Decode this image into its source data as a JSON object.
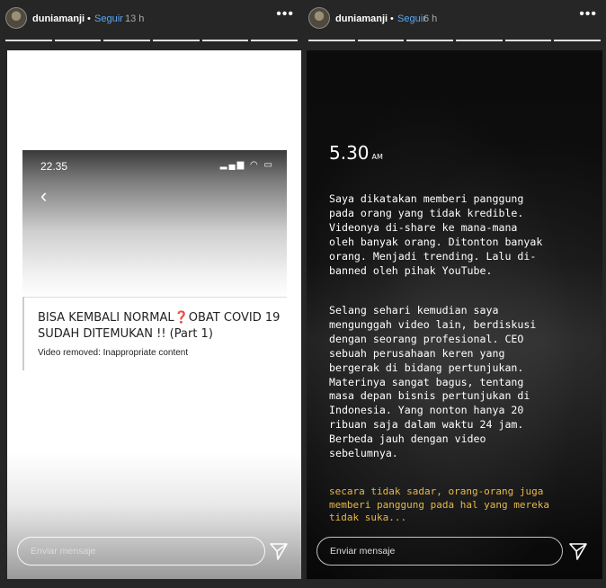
{
  "stories": [
    {
      "username": "duniamanji",
      "separator": "•",
      "follow_label": "Seguir",
      "time": "13 h",
      "more_icon": "more-options-icon",
      "phone": {
        "clock": "22.35",
        "status_icons": "signal-wifi-battery-icons",
        "back_icon": "chevron-left-icon",
        "back_glyph": "‹",
        "video_title": "BISA KEMBALI NORMAL❓OBAT COVID 19 SUDAH DITEMUKAN !!  (Part 1)",
        "video_status": "Video removed: Inappropriate content"
      },
      "message_placeholder": "Enviar mensaje",
      "send_icon": "paper-plane-send-icon"
    },
    {
      "username": "duniamanji",
      "separator": "•",
      "follow_label": "Seguir",
      "time": "6 h",
      "more_icon": "more-options-icon",
      "clock": "5.30",
      "clock_suffix": "AM",
      "paragraph_1": "Saya dikatakan memberi panggung\npada orang yang tidak kredible.\nVideonya di-share ke mana-mana\noleh banyak orang. Ditonton banyak\norang. Menjadi trending. Lalu di-\nbanned oleh pihak YouTube.",
      "paragraph_2": "Selang sehari kemudian saya\nmengunggah video lain, berdiskusi\ndengan seorang profesional. CEO\nsebuah perusahaan keren yang\nbergerak di bidang pertunjukan.\nMaterinya sangat bagus, tentang\nmasa depan bisnis pertunjukan di\nIndonesia. Yang nonton hanya 20\nribuan saja dalam waktu 24 jam.\nBerbeda jauh dengan video\nsebelumnya.",
      "paragraph_3": "secara tidak sadar, orang-orang juga\nmemberi panggung pada hal yang mereka\ntidak suka...",
      "message_placeholder": "Enviar mensaje",
      "send_icon": "paper-plane-send-icon"
    }
  ]
}
